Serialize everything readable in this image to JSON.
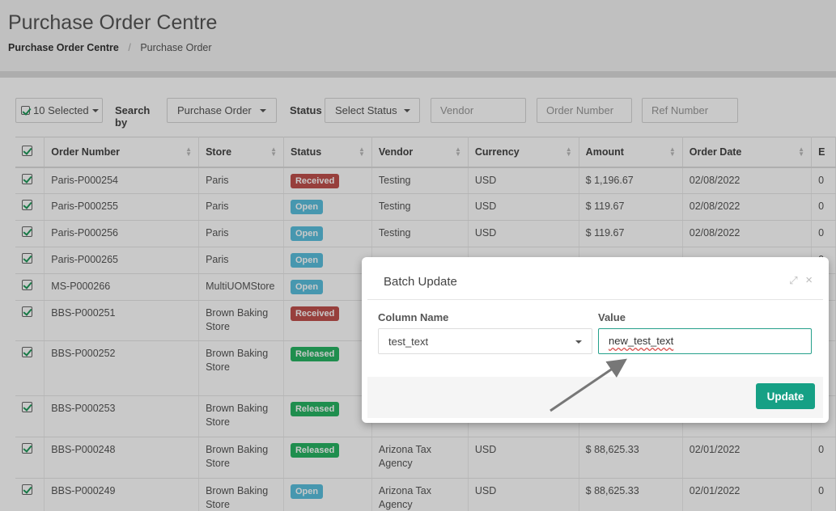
{
  "header": {
    "title": "Purchase Order Centre",
    "breadcrumb": [
      "Purchase Order Centre",
      "Purchase Order"
    ],
    "breadcrumb_sep": "/"
  },
  "toolbar": {
    "selected_label": "10 Selected",
    "search_by_label": "Search by",
    "search_by_value": "Purchase Order",
    "status_label": "Status",
    "status_placeholder": "Select Status",
    "vendor_placeholder": "Vendor",
    "order_number_placeholder": "Order Number",
    "ref_number_placeholder": "Ref Number"
  },
  "table": {
    "columns": [
      "Order Number",
      "Store",
      "Status",
      "Vendor",
      "Currency",
      "Amount",
      "Order Date",
      "E"
    ],
    "rows": [
      {
        "order": "Paris-P000254",
        "store": "Paris",
        "status": "Received",
        "status_type": "received",
        "vendor": "Testing",
        "currency": "USD",
        "amount": "$ 1,196.67",
        "date": "02/08/2022",
        "extra": "0"
      },
      {
        "order": "Paris-P000255",
        "store": "Paris",
        "status": "Open",
        "status_type": "open",
        "vendor": "Testing",
        "currency": "USD",
        "amount": "$ 119.67",
        "date": "02/08/2022",
        "extra": "0"
      },
      {
        "order": "Paris-P000256",
        "store": "Paris",
        "status": "Open",
        "status_type": "open",
        "vendor": "Testing",
        "currency": "USD",
        "amount": "$ 119.67",
        "date": "02/08/2022",
        "extra": "0"
      },
      {
        "order": "Paris-P000265",
        "store": "Paris",
        "status": "Open",
        "status_type": "open",
        "vendor": "",
        "currency": "",
        "amount": "",
        "date": "",
        "extra": "0"
      },
      {
        "order": "MS-P000266",
        "store": "MultiUOMStore",
        "status": "Open",
        "status_type": "open",
        "vendor": "",
        "currency": "",
        "amount": "",
        "date": "",
        "extra": "0"
      },
      {
        "order": "BBS-P000251",
        "store": "Brown Baking Store",
        "status": "Received",
        "status_type": "received",
        "vendor": "",
        "currency": "",
        "amount": "",
        "date": "",
        "extra": "0"
      },
      {
        "order": "BBS-P000252",
        "store": "Brown Baking Store",
        "status": "Released",
        "status_type": "released",
        "vendor": "",
        "currency": "",
        "amount": "",
        "date": "",
        "extra": "0"
      },
      {
        "order": "BBS-P000253",
        "store": "Brown Baking Store",
        "status": "Released",
        "status_type": "released",
        "vendor": "Agency",
        "currency": "",
        "amount": "",
        "date": "",
        "extra": "0"
      },
      {
        "order": "BBS-P000248",
        "store": "Brown Baking Store",
        "status": "Released",
        "status_type": "released",
        "vendor": "Arizona Tax Agency",
        "currency": "USD",
        "amount": "$ 88,625.33",
        "date": "02/01/2022",
        "extra": "0"
      },
      {
        "order": "BBS-P000249",
        "store": "Brown Baking Store",
        "status": "Open",
        "status_type": "open",
        "vendor": "Arizona Tax Agency",
        "currency": "USD",
        "amount": "$ 88,625.33",
        "date": "02/01/2022",
        "extra": "0"
      }
    ]
  },
  "modal": {
    "title": "Batch Update",
    "column_name_label": "Column Name",
    "value_label": "Value",
    "column_name_value": "test_text",
    "value_value": "new_test_text",
    "update_label": "Update",
    "expand_icon": "expand-icon",
    "close_icon": "close-icon",
    "expand_glyph": "⤢",
    "close_glyph": "×"
  },
  "colors": {
    "accent": "#16a085",
    "received": "#c0504d",
    "open": "#5bc0de",
    "released": "#28b463"
  }
}
